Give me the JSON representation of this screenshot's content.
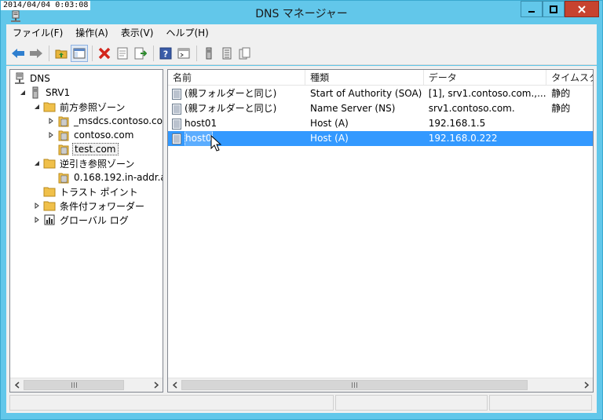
{
  "timestamp": "2014/04/04 0:03:08",
  "window": {
    "title": "DNS マネージャー",
    "min_label": "—",
    "max_label": "□",
    "close_label": "✕"
  },
  "menu": [
    "ファイル(F)",
    "操作(A)",
    "表示(V)",
    "ヘルプ(H)"
  ],
  "toolbar": {
    "icons": [
      "back-arrow-icon",
      "forward-arrow-icon",
      "up-folder-icon",
      "show-tree-icon",
      "delete-icon",
      "properties-icon",
      "export-list-icon",
      "help-icon",
      "console-icon",
      "server-icon",
      "list-icon",
      "copy-icon"
    ]
  },
  "tree": {
    "nodes": [
      {
        "label": "DNS",
        "icon": "dns-icon",
        "level": 0,
        "expander": "none"
      },
      {
        "label": "SRV1",
        "icon": "server-icon",
        "level": 1,
        "expander": "expanded"
      },
      {
        "label": "前方参照ゾーン",
        "icon": "folder-icon",
        "level": 2,
        "expander": "expanded"
      },
      {
        "label": "_msdcs.contoso.co",
        "icon": "zone-icon",
        "level": 3,
        "expander": "collapsed"
      },
      {
        "label": "contoso.com",
        "icon": "zone-icon",
        "level": 3,
        "expander": "collapsed"
      },
      {
        "label": "test.com",
        "icon": "zone-icon",
        "level": 3,
        "expander": "none",
        "selected": true
      },
      {
        "label": "逆引き参照ゾーン",
        "icon": "folder-icon",
        "level": 2,
        "expander": "expanded"
      },
      {
        "label": "0.168.192.in-addr.a",
        "icon": "zone-icon",
        "level": 3,
        "expander": "none"
      },
      {
        "label": "トラスト ポイント",
        "icon": "folder-icon",
        "level": 2,
        "expander": "none"
      },
      {
        "label": "条件付フォワーダー",
        "icon": "folder-icon",
        "level": 2,
        "expander": "collapsed"
      },
      {
        "label": "グローバル ログ",
        "icon": "log-icon",
        "level": 2,
        "expander": "collapsed"
      }
    ]
  },
  "list": {
    "columns": [
      "名前",
      "種類",
      "データ",
      "タイムスタ"
    ],
    "rows": [
      {
        "name": "(親フォルダーと同じ)",
        "type": "Start of Authority (SOA)",
        "data": "[1], srv1.contoso.com.,...",
        "ts": "静的"
      },
      {
        "name": "(親フォルダーと同じ)",
        "type": "Name Server (NS)",
        "data": "srv1.contoso.com.",
        "ts": "静的"
      },
      {
        "name": "host01",
        "type": "Host (A)",
        "data": "192.168.1.5",
        "ts": ""
      },
      {
        "name": "host0",
        "type": "Host (A)",
        "data": "192.168.0.222",
        "ts": "",
        "selected": true
      }
    ]
  },
  "scrollbars": {
    "left_thumb_fraction": 0.8,
    "right_thumb_fraction": 0.87
  },
  "colors": {
    "titlebar": "#62c7ea",
    "close": "#c7432f",
    "selection": "#3399ff"
  }
}
